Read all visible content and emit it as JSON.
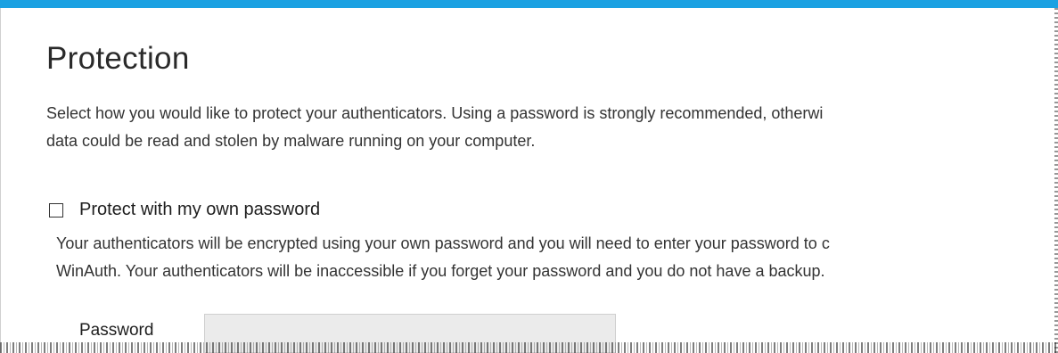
{
  "page": {
    "title": "Protection",
    "description": [
      "Select how you would like to protect your authenticators. Using a password is strongly recommended, otherwi",
      "data could be read and stolen by malware running on your computer."
    ]
  },
  "password_option": {
    "label": "Protect with my own password",
    "checked": false,
    "description": [
      "Your authenticators will be encrypted using your own password and you will need to enter your password to c",
      "WinAuth. Your authenticators will be inaccessible if you forget your password and you do not have a backup."
    ],
    "field_label": "Password",
    "field_value": ""
  },
  "colors": {
    "accent": "#1ba1e2",
    "input_background": "#ebebeb"
  }
}
